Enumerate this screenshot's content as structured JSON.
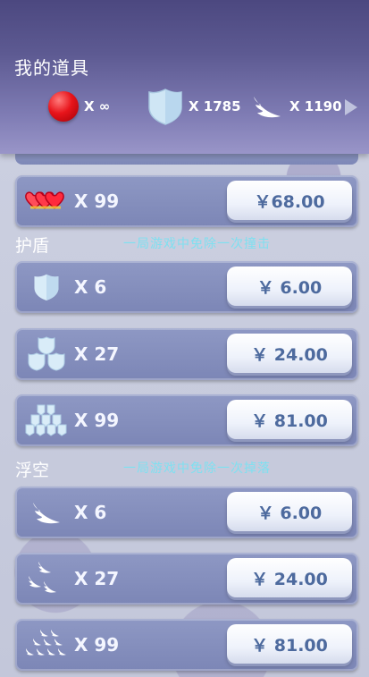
{
  "header": {
    "title": "我的道具",
    "resources": [
      {
        "icon": "red-ball-icon",
        "count": "X ∞"
      },
      {
        "icon": "shield-icon",
        "count": "X 1785"
      },
      {
        "icon": "wing-icon",
        "count": "X 1190"
      }
    ]
  },
  "hearts_item": {
    "icon": "hearts-icon",
    "qty": "X 99",
    "price": "￥68.00"
  },
  "sections": [
    {
      "title": "护盾",
      "desc": "一局游戏中免除一次撞击",
      "items": [
        {
          "icon": "shield-icon",
          "qty": "X 6",
          "price": "￥ 6.00"
        },
        {
          "icon": "shield-stack-icon",
          "qty": "X 27",
          "price": "￥ 24.00"
        },
        {
          "icon": "shield-pile-icon",
          "qty": "X 99",
          "price": "￥ 81.00"
        }
      ]
    },
    {
      "title": "浮空",
      "desc": "一局游戏中免除一次掉落",
      "items": [
        {
          "icon": "wing-icon",
          "qty": "X 6",
          "price": "￥ 6.00"
        },
        {
          "icon": "wing-group-icon",
          "qty": "X 27",
          "price": "￥ 24.00"
        },
        {
          "icon": "wing-pile-icon",
          "qty": "X 99",
          "price": "￥ 81.00"
        }
      ]
    }
  ],
  "colors": {
    "accent_text": "#7fe0f0",
    "price_text": "#4d6a9e",
    "header_top": "#4c4880"
  }
}
